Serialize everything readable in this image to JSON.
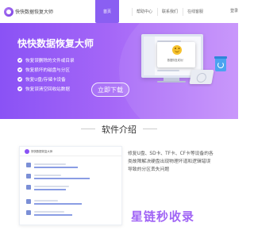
{
  "header": {
    "brand": "快快数据恢复大师",
    "nav": [
      {
        "label": "首页",
        "active": true
      },
      {
        "label": "帮助中心",
        "active": false
      },
      {
        "label": "联系我们",
        "active": false
      },
      {
        "label": "在线客服",
        "active": false
      }
    ],
    "right_label": "登录"
  },
  "hero": {
    "title": "快快数据恢复大师",
    "features": [
      "恢复误删除的文件或目录",
      "恢复损坏的磁盘与分区",
      "恢复U盘/存储卡设备",
      "恢复误清空回收站数据"
    ],
    "download_label": "立即下载",
    "dialog_text": "数据恢复成功！",
    "colors": {
      "gradient_start": "#8a52f5",
      "gradient_end": "#c58ffb",
      "accent": "#8a5ff2"
    }
  },
  "intro": {
    "section_title": "软件介绍",
    "app_title": "快快数据恢复大师",
    "description": "修复U盘、SD卡、TF卡、CF卡等设备的各类故障解决硬盘出现物理坏道和逻辑错误导致的分区丢失问题",
    "watermark": "星链秒收录"
  }
}
